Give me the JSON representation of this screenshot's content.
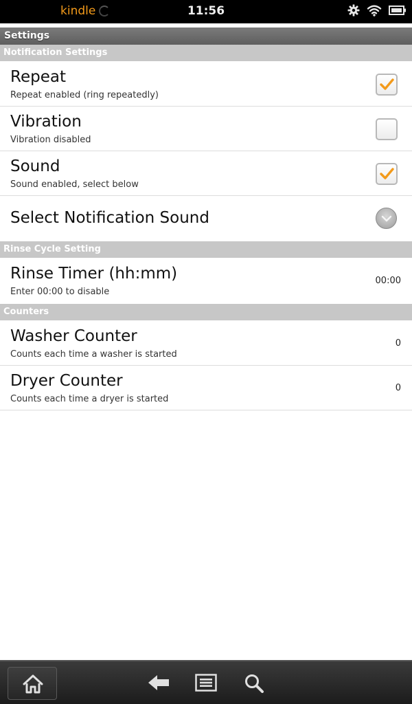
{
  "status_bar": {
    "brand": "kindle",
    "time": "11:56",
    "icons": [
      "gear-icon",
      "wifi-icon",
      "battery-icon"
    ]
  },
  "title_bar": {
    "title": "Settings"
  },
  "sections": {
    "notification": {
      "header": "Notification Settings",
      "repeat": {
        "title": "Repeat",
        "summary": "Repeat enabled (ring repeatedly)",
        "checked": true
      },
      "vibration": {
        "title": "Vibration",
        "summary": "Vibration disabled",
        "checked": false
      },
      "sound": {
        "title": "Sound",
        "summary": "Sound enabled, select below",
        "checked": true
      },
      "select_sound": {
        "title": "Select Notification Sound"
      }
    },
    "rinse": {
      "header": "Rinse Cycle Setting",
      "timer": {
        "title": "Rinse Timer (hh:mm)",
        "summary": "Enter 00:00 to disable",
        "value": "00:00"
      }
    },
    "counters": {
      "header": "Counters",
      "washer": {
        "title": "Washer Counter",
        "summary": "Counts each time a washer is started",
        "value": "0"
      },
      "dryer": {
        "title": "Dryer Counter",
        "summary": "Counts each time a dryer is started",
        "value": "0"
      }
    }
  },
  "nav_bar": {
    "icons": [
      "home-icon",
      "back-icon",
      "menu-icon",
      "search-icon"
    ]
  },
  "colors": {
    "accent": "#f39a1a",
    "section_header": "#c7c7c7",
    "title_bar": "#6a6a6a"
  }
}
